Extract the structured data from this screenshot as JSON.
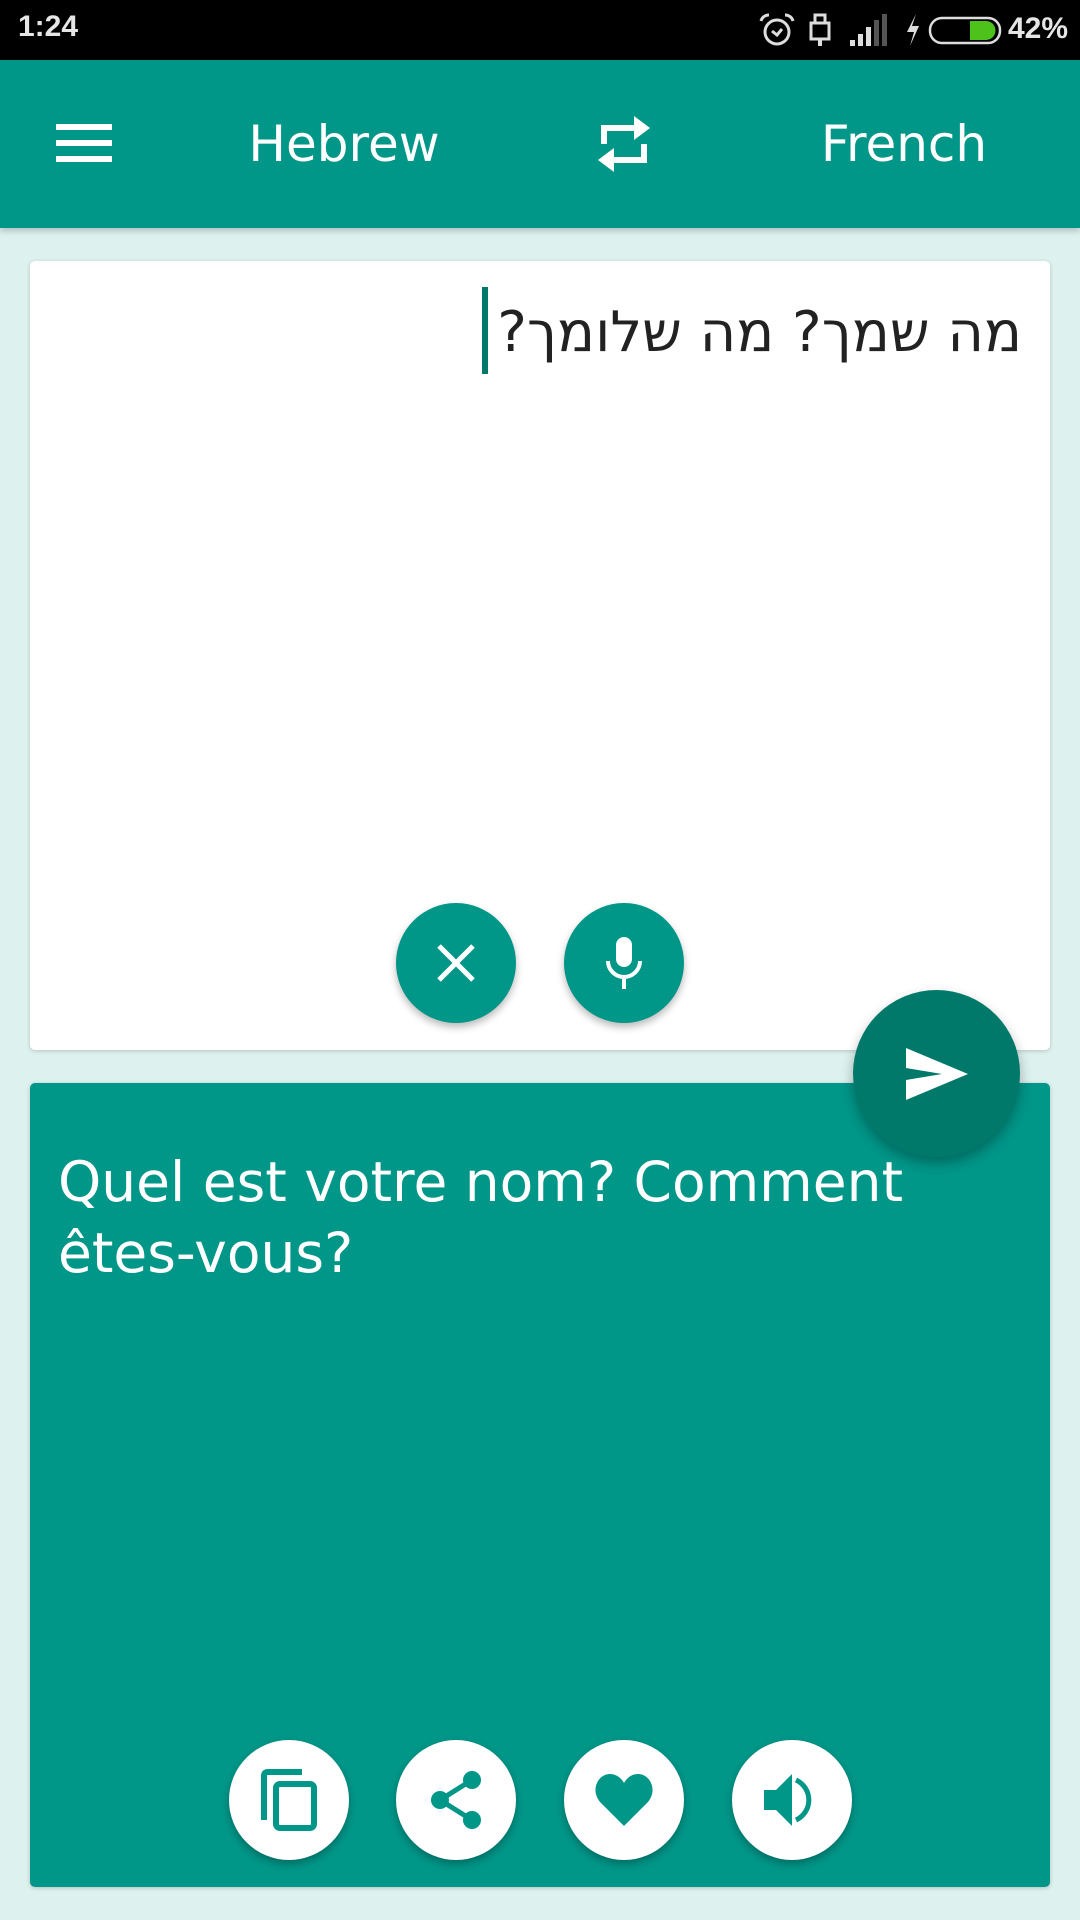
{
  "status_bar": {
    "time": "1:24",
    "battery_percent": "42%",
    "battery_level": 0.42,
    "icons": [
      "alarm-icon",
      "usb-icon",
      "signal-icon",
      "charging-icon",
      "battery-icon"
    ]
  },
  "toolbar": {
    "menu_icon": "hamburger-menu-icon",
    "source_language": "Hebrew",
    "swap_icon": "swap-languages-icon",
    "target_language": "French"
  },
  "input_card": {
    "text": "מה שמך? מה שלומך?",
    "clear_icon": "close-icon",
    "mic_icon": "microphone-icon"
  },
  "translate_button": {
    "icon": "send-icon"
  },
  "output_card": {
    "text": "Quel est votre nom? Comment êtes-vous?",
    "actions": [
      "copy-icon",
      "share-icon",
      "favorite-heart-icon",
      "speaker-icon"
    ]
  },
  "colors": {
    "primary": "#009688",
    "primary_dark": "#00796B",
    "background": "#DDF1EE",
    "status_bar": "#000000",
    "battery_fill": "#4CC21A"
  }
}
